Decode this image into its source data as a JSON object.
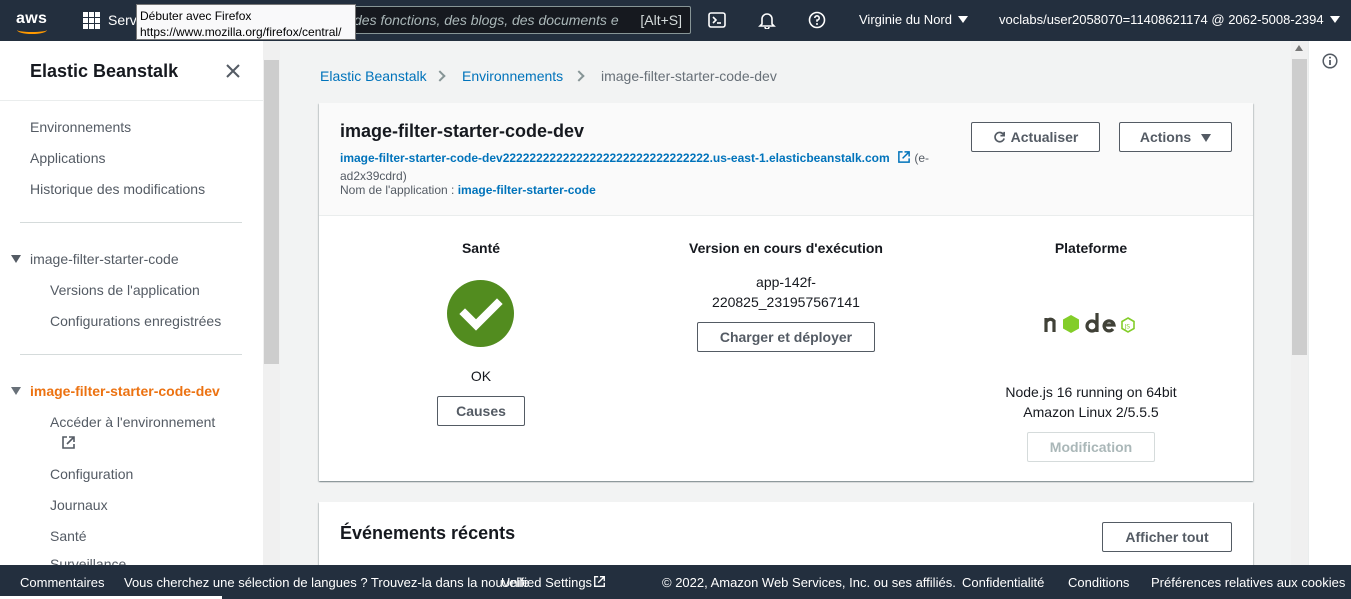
{
  "topnav": {
    "services_label": "Servi",
    "search_placeholder": "des fonctions, des blogs, des documents et p",
    "search_shortcut": "[Alt+S]",
    "region": "Virginie du Nord",
    "account": "voclabs/user2058070=11408621174 @ 2062-5008-2394"
  },
  "tooltip": {
    "line1": "Débuter avec Firefox",
    "line2": "https://www.mozilla.org/firefox/central/"
  },
  "sidebar": {
    "title": "Elastic Beanstalk",
    "items": [
      "Environnements",
      "Applications",
      "Historique des modifications"
    ],
    "app_section": "image-filter-starter-code",
    "app_items": [
      "Versions de l'application",
      "Configurations enregistrées"
    ],
    "env_section": "image-filter-starter-code-dev",
    "env_items": [
      "Accéder à l'environnement",
      "Configuration",
      "Journaux",
      "Santé",
      "Surveillance"
    ]
  },
  "breadcrumb": {
    "items": [
      "Elastic Beanstalk",
      "Environnements"
    ],
    "current": "image-filter-starter-code-dev"
  },
  "environment": {
    "title": "image-filter-starter-code-dev",
    "url": "image-filter-starter-code-dev2222222222222222222222222222222.us-east-1.elasticbeanstalk.com",
    "env_id": "(e-ad2x39cdrd)",
    "app_label": "Nom de l'application :",
    "app_name": "image-filter-starter-code",
    "refresh_label": "Actualiser",
    "actions_label": "Actions"
  },
  "health": {
    "title": "Santé",
    "status": "OK",
    "causes_label": "Causes",
    "color": "#528c1f"
  },
  "version": {
    "title": "Version en cours d'exécution",
    "line1": "app-142f-",
    "line2": "220825_231957567141",
    "deploy_label": "Charger et déployer"
  },
  "platform": {
    "title": "Plateforme",
    "line1": "Node.js 16 running on 64bit",
    "line2": "Amazon Linux 2/5.5.5",
    "modify_label": "Modification"
  },
  "events": {
    "title": "Événements récents",
    "show_all_label": "Afficher tout"
  },
  "footer": {
    "feedback": "Commentaires",
    "language_text": "Vous cherchez une sélection de langues ? Trouvez-la dans la nouvelle",
    "unified_settings": "Unified Settings",
    "copyright": "© 2022, Amazon Web Services, Inc. ou ses affiliés.",
    "privacy": "Confidentialité",
    "terms": "Conditions",
    "cookies": "Préférences relatives aux cookies"
  },
  "colors": {
    "nav_bg": "#232f3e",
    "link": "#0073bb",
    "active": "#ec7211"
  }
}
